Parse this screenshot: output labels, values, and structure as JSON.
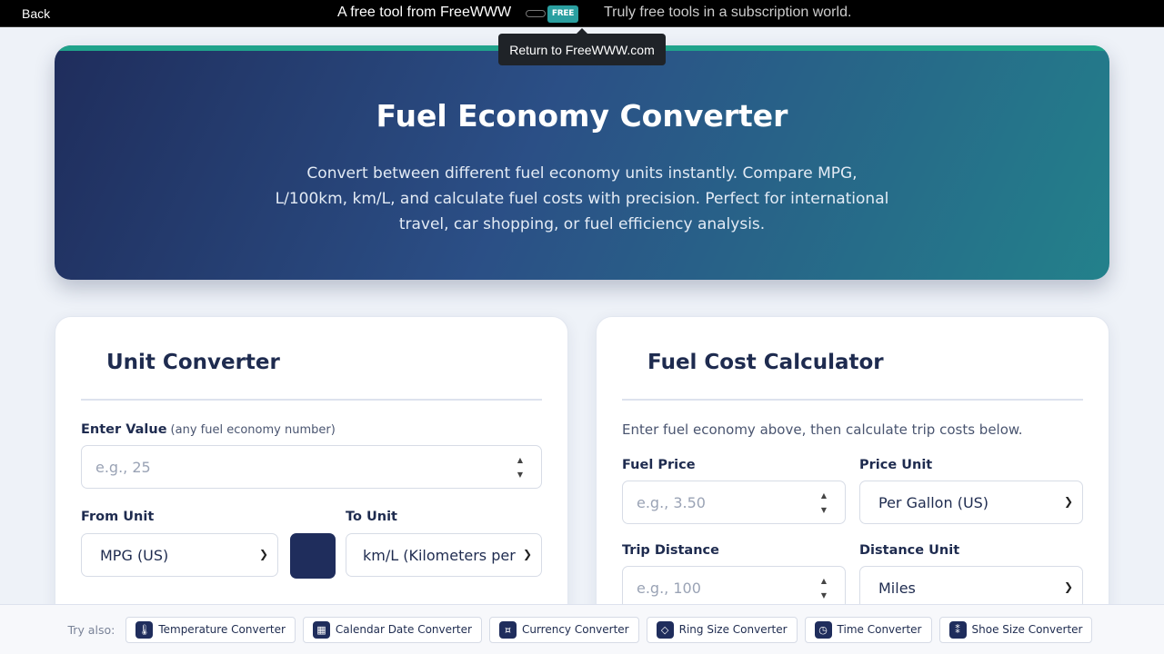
{
  "topbar": {
    "back_label": "Back",
    "tagline": "A free tool from FreeWWW",
    "logo_text": "FREE",
    "subtagline": "Truly free tools in a subscription world."
  },
  "tooltip": {
    "text": "Return to FreeWWW.com"
  },
  "hero": {
    "title": "Fuel Economy Converter",
    "description": "Convert between different fuel economy units instantly. Compare MPG, L/100km, km/L, and calculate fuel costs with precision. Perfect for international travel, car shopping, or fuel efficiency analysis."
  },
  "unit_converter": {
    "title": "Unit Converter",
    "value_label": "Enter Value",
    "value_hint": "(any fuel economy number)",
    "value_placeholder": "e.g., 25",
    "from_label": "From Unit",
    "from_value": "MPG (US)",
    "to_label": "To Unit",
    "to_value": "km/L (Kilometers per L"
  },
  "cost_calculator": {
    "title": "Fuel Cost Calculator",
    "intro": "Enter fuel economy above, then calculate trip costs below.",
    "price_label": "Fuel Price",
    "price_placeholder": "e.g., 3.50",
    "price_unit_label": "Price Unit",
    "price_unit_value": "Per Gallon (US)",
    "distance_label": "Trip Distance",
    "distance_placeholder": "e.g., 100",
    "distance_unit_label": "Distance Unit",
    "distance_unit_value": "Miles"
  },
  "footer": {
    "try_label": "Try also:",
    "links": [
      {
        "label": "Temperature Converter",
        "icon": "thermometer-icon"
      },
      {
        "label": "Calendar Date Converter",
        "icon": "calendar-icon"
      },
      {
        "label": "Currency Converter",
        "icon": "currency-icon"
      },
      {
        "label": "Ring Size Converter",
        "icon": "ring-icon"
      },
      {
        "label": "Time Converter",
        "icon": "clock-icon"
      },
      {
        "label": "Shoe Size Converter",
        "icon": "footprints-icon"
      }
    ]
  },
  "colors": {
    "navy": "#1f2d5c",
    "teal": "#20a38b",
    "background": "#eef2f8"
  }
}
